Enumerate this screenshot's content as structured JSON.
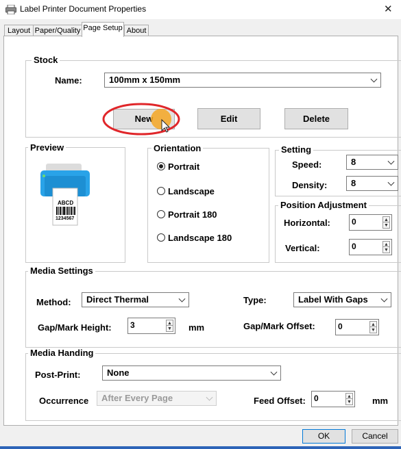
{
  "window": {
    "title": "Label Printer Document Properties",
    "close_glyph": "✕"
  },
  "tabs": [
    {
      "label": "Layout"
    },
    {
      "label": "Paper/Quality"
    },
    {
      "label": "Page Setup"
    },
    {
      "label": "About"
    }
  ],
  "stock": {
    "legend": "Stock",
    "name_label": "Name:",
    "name_value": "100mm x 150mm",
    "new_label": "New",
    "edit_label": "Edit",
    "delete_label": "Delete"
  },
  "preview": {
    "legend": "Preview",
    "label_text": "ABCD",
    "barcode_number": "1234567"
  },
  "orientation": {
    "legend": "Orientation",
    "options": [
      "Portrait",
      "Landscape",
      "Portrait 180",
      "Landscape 180"
    ],
    "selected": "Portrait"
  },
  "setting": {
    "legend": "Setting",
    "speed_label": "Speed:",
    "speed_value": "8",
    "density_label": "Density:",
    "density_value": "8"
  },
  "position": {
    "legend": "Position Adjustment",
    "horizontal_label": "Horizontal:",
    "horizontal_value": "0",
    "vertical_label": "Vertical:",
    "vertical_value": "0"
  },
  "media_settings": {
    "legend": "Media Settings",
    "method_label": "Method:",
    "method_value": "Direct Thermal",
    "type_label": "Type:",
    "type_value": "Label With Gaps",
    "gap_height_label": "Gap/Mark Height:",
    "gap_height_value": "3",
    "gap_height_unit": "mm",
    "gap_offset_label": "Gap/Mark Offset:",
    "gap_offset_value": "0"
  },
  "media_handing": {
    "legend": "Media Handing",
    "post_print_label": "Post-Print:",
    "post_print_value": "None",
    "occurrence_label": "Occurrence",
    "occurrence_value": "After Every Page",
    "feed_offset_label": "Feed Offset:",
    "feed_offset_value": "0",
    "feed_offset_unit": "mm"
  },
  "footer": {
    "ok_label": "OK",
    "cancel_label": "Cancel"
  },
  "colors": {
    "highlight_circle": "#e0262a",
    "cursor_dot": "#f5a623",
    "printer_blue": "#29a3e8"
  }
}
